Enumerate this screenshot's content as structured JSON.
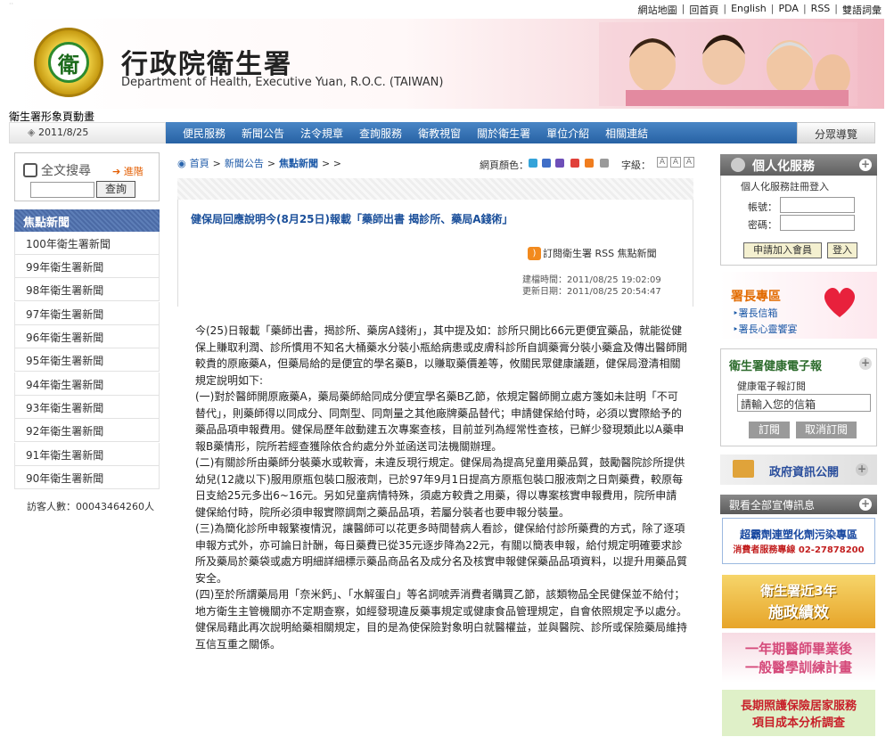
{
  "top_links": [
    "網站地圖",
    "回首頁",
    "English",
    "PDA",
    "RSS",
    "雙語詞彙"
  ],
  "header": {
    "title_zh": "行政院衛生署",
    "title_en": "Department of Health, Executive Yuan, R.O.C. (TAIWAN)",
    "logo_text": "衛",
    "subtitle": "衛生署形象頁動畫"
  },
  "date": "2011/8/25",
  "nav": [
    "便民服務",
    "新聞公告",
    "法令規章",
    "查詢服務",
    "衛教視窗",
    "關於衛生署",
    "單位介紹",
    "相關連結"
  ],
  "nav_right": "分眾導覽",
  "search": {
    "title": "全文搜尋",
    "advanced": "進階",
    "button": "查詢"
  },
  "news": {
    "heading": "焦點新聞",
    "items": [
      "100年衛生署新聞",
      "99年衛生署新聞",
      "98年衛生署新聞",
      "97年衛生署新聞",
      "96年衛生署新聞",
      "95年衛生署新聞",
      "94年衛生署新聞",
      "93年衛生署新聞",
      "92年衛生署新聞",
      "91年衛生署新聞",
      "90年衛生署新聞"
    ]
  },
  "visitor": "訪客人數：00043464260人",
  "breadcrumb": {
    "home": "首頁",
    "sep": ">",
    "section": "新聞公告",
    "current": "焦點新聞",
    "tail": "> >"
  },
  "page_color_label": "網頁顏色：",
  "page_colors": [
    "#34a3d9",
    "#3f6ec7",
    "#6e4fb8",
    "#e0403a",
    "#f07d1f",
    "#9a9a9a"
  ],
  "font_size_label": "字級：",
  "font_sizes": [
    "A",
    "A",
    "A"
  ],
  "article": {
    "title": "健保局回應說明今(8月25日)報載「藥師出書 揭診所、藥局A錢術」",
    "rss": "訂閱衛生署 RSS 焦點新聞",
    "created": "建檔時間：2011/08/25 19:02:09",
    "updated": "更新日期：2011/08/25 20:54:47",
    "paragraphs": [
      "今(25)日報載「藥師出書，揭診所、藥房A錢術」，其中提及如：診所只開比66元更便宜藥品，就能從健保上賺取利潤、診所慣用不知名大桶藥水分裝小瓶給病患或皮膚科診所自調藥膏分裝小藥盒及傳出醫師開較貴的原廠藥A，但藥局給的是便宜的學名藥B，以賺取藥價差等，攸關民眾健康議題，健保局澄清相關規定說明如下:",
      "(一)對於醫師開原廠藥A，藥局藥師給同成分便宜學名藥B乙節，依規定醫師開立處方箋如未註明「不可替代」，則藥師得以同成分、同劑型、同劑量之其他廠牌藥品替代；申請健保給付時，必須以實際給予的藥品品項申報費用。健保局歷年啟動建五次專案查核，目前並列為經常性查核，已鮮少發現類此以A藥申報B藥情形，院所若經查獲除依合約處分外並函送司法機關辦理。",
      "(二)有關診所由藥師分裝藥水或軟膏，未違反現行規定。健保局為提高兒童用藥品質，鼓勵醫院診所提供幼兒(12歲以下)服用原瓶包裝口服液劑，已於97年9月1日提高方原瓶包裝口服液劑之日劑藥費，較原每日支給25元多出6~16元。另如兒童病情特殊，須處方較貴之用藥，得以專案核實申報費用，院所申請健保給付時，院所必須申報實際調劑之藥品品項，若屬分裝者也要申報分裝量。",
      "(三)為簡化診所申報繁複情況，讓醫師可以花更多時間替病人看診，健保給付診所藥費的方式，除了逐項申報方式外，亦可論日計酬，每日藥費已從35元逐步降為22元，有關以簡表申報，給付規定明確要求診所及藥局於藥袋或處方明細詳細標示藥品商品名及成分名及核實申報健保藥品品項資料，以提升用藥品質安全。",
      "(四)至於所謂藥局用「奈米鈣」、「水解蛋白」等名詞唬弄消費者購買乙節，該類物品全民健保並不給付；地方衛生主管機關亦不定期查察，如經發現違反藥事規定或健康食品管理規定，自會依照規定予以處分。",
      "健保局藉此再次說明給藥相關規定，目的是為使保險對象明白就醫權益，並與醫院、診所或保險藥局維持互信互重之關係。"
    ]
  },
  "personal": {
    "title": "個人化服務",
    "sub": "個人化服務註冊登入",
    "account_label": "帳號：",
    "password_label": "密碼：",
    "join_button": "申請加入會員",
    "login_button": "登入"
  },
  "chief": {
    "title": "署長專區",
    "links": [
      "署長信箱",
      "署長心靈饗宴"
    ]
  },
  "enews": {
    "title": "衛生署健康電子報",
    "sub": "健康電子報訂閱",
    "placeholder": "請輸入您的信箱",
    "subscribe": "訂閱",
    "unsubscribe": "取消訂閱"
  },
  "gov_open": "政府資訊公開",
  "ads_head": "觀看全部宣傳訊息",
  "ads": [
    {
      "line1": "超霸劑連塑化劑污染專區",
      "line2": "消費者服務專線 02-27878200"
    },
    {
      "line1": "衛生署近3年",
      "line2": "施政績效"
    },
    {
      "line1": "一年期醫師畢業後",
      "line2": "一般醫學訓練計畫"
    },
    {
      "line1": "長期照護保險居家服務",
      "line2": "項目成本分析調查"
    }
  ]
}
